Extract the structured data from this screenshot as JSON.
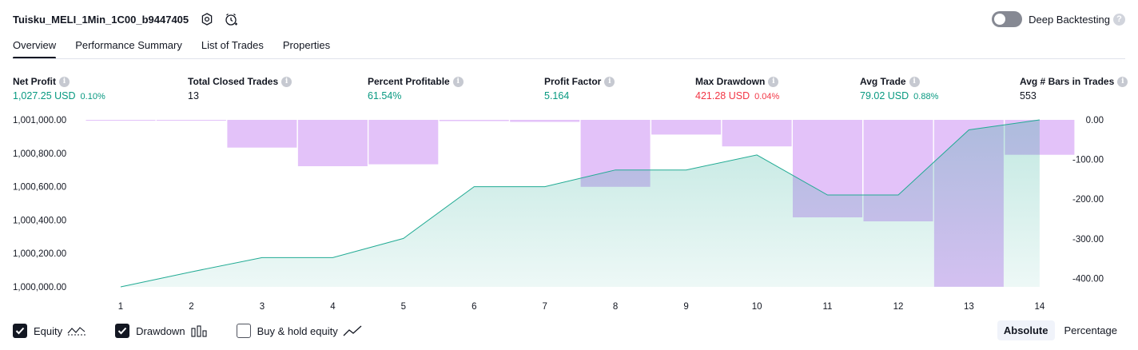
{
  "header": {
    "title": "Tuisku_MELI_1Min_1C00_b9447405",
    "deep_backtesting_label": "Deep Backtesting",
    "deep_backtesting_enabled": false
  },
  "tabs": [
    {
      "label": "Overview",
      "active": true
    },
    {
      "label": "Performance Summary",
      "active": false
    },
    {
      "label": "List of Trades",
      "active": false
    },
    {
      "label": "Properties",
      "active": false
    }
  ],
  "metrics": {
    "net_profit": {
      "label": "Net Profit",
      "value": "1,027.25 USD",
      "pct": "0.10%"
    },
    "total_closed_trades": {
      "label": "Total Closed Trades",
      "value": "13"
    },
    "percent_profitable": {
      "label": "Percent Profitable",
      "value": "61.54%"
    },
    "profit_factor": {
      "label": "Profit Factor",
      "value": "5.164"
    },
    "max_drawdown": {
      "label": "Max Drawdown",
      "value": "421.28 USD",
      "pct": "0.04%"
    },
    "avg_trade": {
      "label": "Avg Trade",
      "value": "79.02 USD",
      "pct": "0.88%"
    },
    "avg_bars": {
      "label": "Avg # Bars in Trades",
      "value": "553"
    }
  },
  "colors": {
    "positive": "#089981",
    "negative": "#f23645",
    "equity_line": "#22ab94",
    "drawdown_bar": "#e1bff9"
  },
  "chart_data": {
    "type": "line",
    "x": [
      1,
      2,
      3,
      4,
      5,
      6,
      7,
      8,
      9,
      10,
      11,
      12,
      13,
      14
    ],
    "x_tick_labels": [
      "1",
      "2",
      "3",
      "4",
      "5",
      "6",
      "7",
      "8",
      "9",
      "10",
      "11",
      "12",
      "13",
      "14"
    ],
    "series": [
      {
        "name": "Equity",
        "axis": "left",
        "style": "line-with-area",
        "values": [
          1000000,
          1000090,
          1000175,
          1000175,
          1000290,
          1000600,
          1000600,
          1000700,
          1000700,
          1000790,
          1000550,
          1000550,
          1000940,
          1001000
        ]
      },
      {
        "name": "Drawdown",
        "axis": "right",
        "style": "bar",
        "values": [
          0,
          -2,
          -70,
          -117,
          -112,
          -3,
          -5,
          -169,
          -37,
          -67,
          -246,
          -256,
          -421,
          -88
        ]
      }
    ],
    "left_axis": {
      "ticks": [
        1000000,
        1000200,
        1000400,
        1000600,
        1000800,
        1001000
      ],
      "tick_labels": [
        "1,000,000.00",
        "1,000,200.00",
        "1,000,400.00",
        "1,000,600.00",
        "1,000,800.00",
        "1,001,000.00"
      ],
      "ylim": [
        1000000,
        1001000
      ]
    },
    "right_axis": {
      "ticks": [
        0,
        -100,
        -200,
        -300,
        -400
      ],
      "tick_labels": [
        "0.00",
        "-100.00",
        "-200.00",
        "-300.00",
        "-400.00"
      ],
      "ylim": [
        -421.28,
        0
      ]
    },
    "grid": false
  },
  "legend": [
    {
      "label": "Equity",
      "checked": true,
      "icon": "equity-line-icon"
    },
    {
      "label": "Drawdown",
      "checked": true,
      "icon": "drawdown-bars-icon"
    },
    {
      "label": "Buy & hold equity",
      "checked": false,
      "icon": "buy-hold-line-icon"
    }
  ],
  "mode_toggle": {
    "options": [
      "Absolute",
      "Percentage"
    ],
    "selected": "Absolute"
  }
}
